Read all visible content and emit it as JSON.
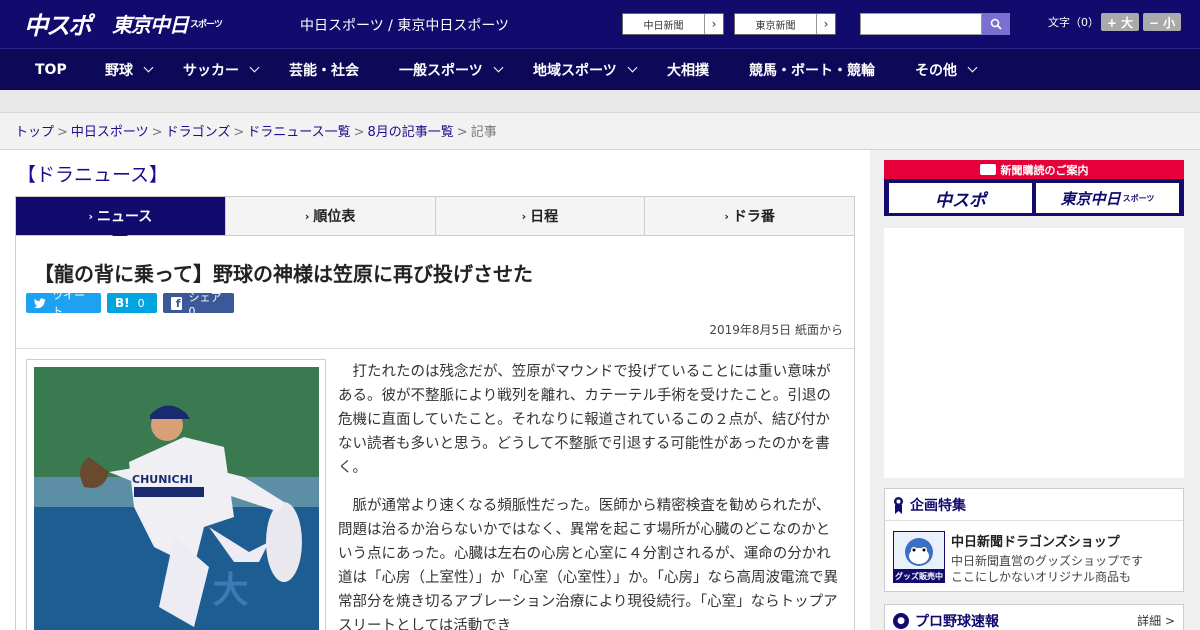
{
  "header": {
    "logo1": "中スポ",
    "logo2": "東京中日",
    "logo2_small": "スポーツ",
    "site_name": "中日スポーツ / 東京中日スポーツ",
    "link1": "中日新聞",
    "link2": "東京新聞",
    "search_placeholder": "",
    "font_size_label": "文字（0）",
    "font_larger": "+ 大",
    "font_smaller": "− 小"
  },
  "nav": [
    "TOP",
    "野球",
    "サッカー",
    "芸能・社会",
    "一般スポーツ",
    "地域スポーツ",
    "大相撲",
    "競馬・ボート・競輪",
    "その他"
  ],
  "breadcrumb": [
    "トップ",
    "中日スポーツ",
    "ドラゴンズ",
    "ドラニュース一覧",
    "8月の記事一覧"
  ],
  "breadcrumb_current": "記事",
  "section_title": "【ドラニュース】",
  "tabs": [
    "ニュース",
    "順位表",
    "日程",
    "ドラ番"
  ],
  "article": {
    "headline": "【龍の背に乗って】野球の神様は笠原に再び投げさせた",
    "tweet": "ツイート",
    "hatena": "0",
    "share": "シェア 0",
    "date": "2019年8月5日 紙面から",
    "p1": "打たれたのは残念だが、笠原がマウンドで投げていることには重い意味がある。彼が不整脈により戦列を離れ、カテーテル手術を受けたこと。引退の危機に直面していたこと。それなりに報道されているこの２点が、結び付かない読者も多いと思う。どうして不整脈で引退する可能性があったのかを書く。",
    "p2": "脈が通常より速くなる頻脈性だった。医師から精密検査を勧められたが、問題は治るか治らないかではなく、異常を起こす場所が心臓のどこなのかという点にあった。心臓は左右の心房と心室に４分割されるが、運命の分かれ道は「心房（上室性）」か「心室（心室性）」か。「心房」なら高周波電流で異常部分を焼き切るアブレーション治療により現役続行。「心室」ならトップアスリートとしては活動でき"
  },
  "sidebar": {
    "banner_head": "新聞購読のご案内",
    "banner_left": "中スポ",
    "banner_right": "東京中日",
    "banner_right_small": "スポーツ",
    "feature_title": "企画特集",
    "feature_item_title": "中日新聞ドラゴンズショップ",
    "feature_item_line1": "中日新聞直営のグッズショップです",
    "feature_item_line2": "ここにしかないオリジナル商品も",
    "feature_thumb_label": "グッズ販売中",
    "scores_title": "プロ野球速報",
    "scores_more": "詳細 >"
  },
  "colors": {
    "brand": "#130a6e",
    "accent": "#e6003a",
    "twitter": "#1da1f2",
    "hatena": "#00a4de",
    "facebook": "#3b5998"
  }
}
